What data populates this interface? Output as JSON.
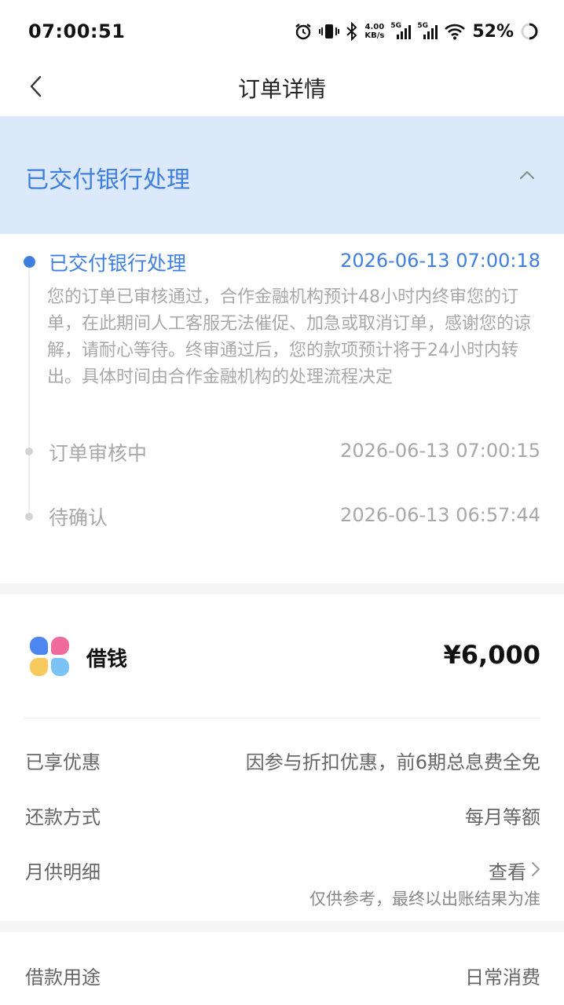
{
  "status_bar": {
    "time": "07:00:51",
    "net_speed_value": "4.00",
    "net_speed_unit": "KB/s",
    "sim1_tag": "5G",
    "sim2_tag": "5G",
    "battery": "52%"
  },
  "nav": {
    "title": "订单详情"
  },
  "banner": {
    "title": "已交付银行处理"
  },
  "timeline": {
    "active": {
      "label": "已交付银行处理",
      "time": "2026-06-13 07:00:18",
      "description": "您的订单已审核通过，合作金融机构预计48小时内终审您的订单，在此期间人工客服无法催促、加急或取消订单，感谢您的谅解，请耐心等待。终审通过后，您的款项预计将于24小时内转出。具体时间由合作金融机构的处理流程决定"
    },
    "steps": [
      {
        "label": "订单审核中",
        "time": "2026-06-13 07:00:15"
      },
      {
        "label": "待确认",
        "time": "2026-06-13 06:57:44"
      }
    ]
  },
  "loan": {
    "name": "借钱",
    "amount": "¥6,000",
    "rows": [
      {
        "label": "已享优惠",
        "value": "因参与折扣优惠，前6期总息费全免"
      },
      {
        "label": "还款方式",
        "value": "每月等额"
      },
      {
        "label": "月供明细",
        "value": "查看"
      }
    ],
    "note": "仅供参考，最终以出账结果为准",
    "logo_colors": [
      "#4d86f0",
      "#ee6b9c",
      "#f8c95c",
      "#7cc3f5"
    ]
  },
  "purpose": {
    "label": "借款用途",
    "value": "日常消费"
  },
  "colors": {
    "accent": "#3f7fe0",
    "banner_bg": "#dbe9fb",
    "muted_text": "#a8a8a8"
  }
}
